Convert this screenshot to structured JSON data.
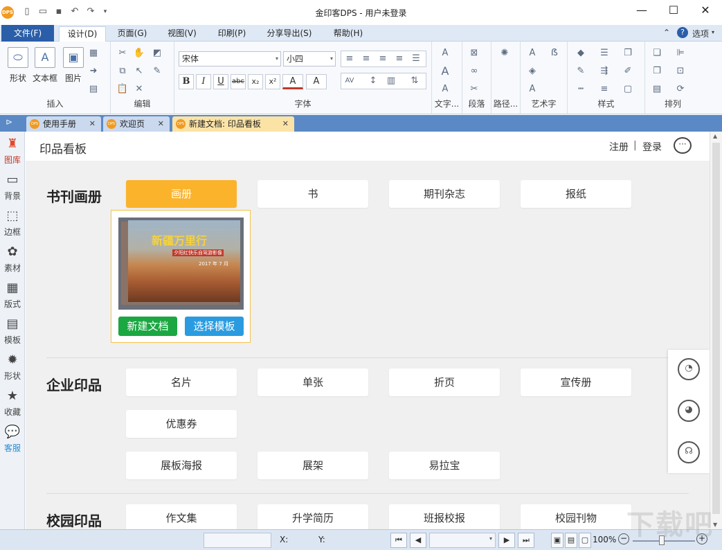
{
  "window": {
    "logo_text": "DPS",
    "title": "金印客DPS - 用户未登录",
    "minimize": "—",
    "maximize": "☐",
    "close": "✕"
  },
  "menu": {
    "items": [
      "文件(F)",
      "设计(D)",
      "页面(G)",
      "视图(V)",
      "印刷(P)",
      "分享导出(S)",
      "帮助(H)"
    ],
    "active": "设计(D)",
    "options_label": "选项"
  },
  "ribbon": {
    "insert": {
      "label": "插入",
      "shape": "形状",
      "textbox": "文本框",
      "image": "图片"
    },
    "edit": {
      "label": "编辑"
    },
    "font": {
      "label": "字体",
      "font_name": "宋体",
      "font_size": "小四"
    },
    "text": {
      "label": "文字..."
    },
    "paragraph": {
      "label": "段落"
    },
    "path": {
      "label": "路径..."
    },
    "art": {
      "label": "艺术字"
    },
    "style": {
      "label": "样式"
    },
    "arrange": {
      "label": "排列"
    }
  },
  "tabs": [
    {
      "label": "使用手册",
      "active": false
    },
    {
      "label": "欢迎页",
      "active": false
    },
    {
      "label": "新建文档: 印品看板",
      "active": true
    }
  ],
  "sidebar": {
    "items": [
      {
        "label": "图库",
        "icon": "gallery-icon"
      },
      {
        "label": "背景",
        "icon": "background-icon"
      },
      {
        "label": "边框",
        "icon": "border-icon"
      },
      {
        "label": "素材",
        "icon": "material-icon"
      },
      {
        "label": "版式",
        "icon": "layout-icon"
      },
      {
        "label": "模板",
        "icon": "template-icon"
      },
      {
        "label": "形状",
        "icon": "shape-icon"
      },
      {
        "label": "收藏",
        "icon": "star-icon"
      },
      {
        "label": "客服",
        "icon": "service-icon"
      }
    ]
  },
  "main": {
    "title": "印品看板",
    "register": "注册",
    "separator": "|",
    "login": "登录",
    "sections": [
      {
        "title": "书刊画册",
        "items": [
          "画册",
          "书",
          "期刊杂志",
          "报纸"
        ]
      },
      {
        "title": "企业印品",
        "items": [
          "名片",
          "单张",
          "折页",
          "宣传册",
          "优惠券",
          "展板海报",
          "展架",
          "易拉宝"
        ]
      },
      {
        "title": "校园印品",
        "items": [
          "作文集",
          "升学简历",
          "班报校报",
          "校园刊物"
        ]
      }
    ],
    "preview": {
      "cover_title": "新疆万里行",
      "cover_subtitle": "夕阳红快乐自驾游影像",
      "cover_date": "2017 年 7 月",
      "new_doc": "新建文档",
      "choose_template": "选择模板"
    }
  },
  "statusbar": {
    "x_label": "X:",
    "y_label": "Y:",
    "zoom": "100%"
  },
  "watermark": "下载吧"
}
